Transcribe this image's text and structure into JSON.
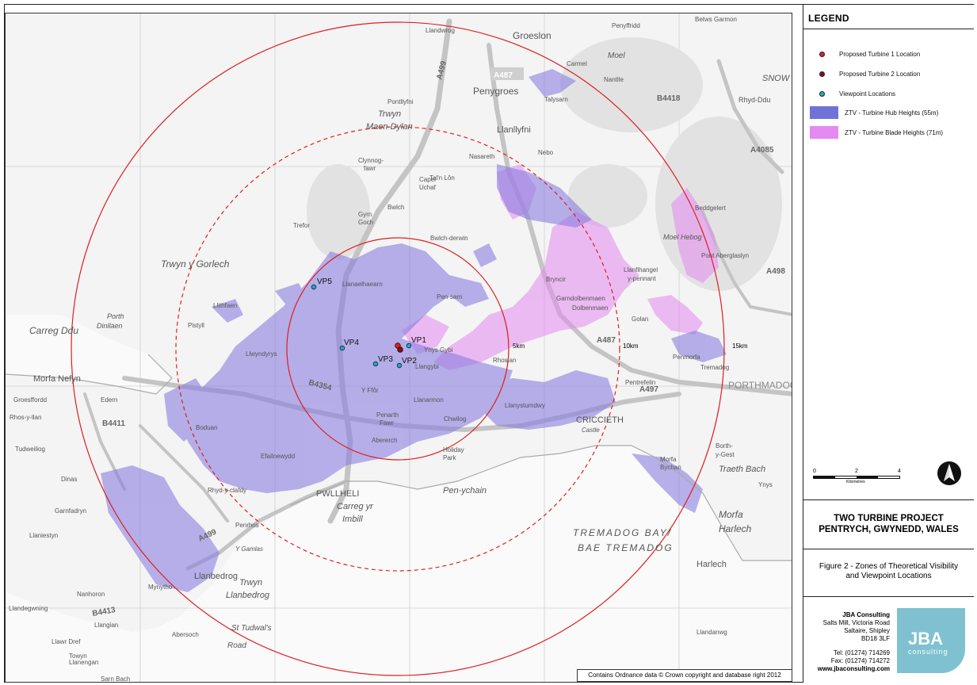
{
  "legend": {
    "title": "LEGEND",
    "items": [
      {
        "label": "Proposed Turbine 1 Location",
        "kind": "dot",
        "color": "#e02020"
      },
      {
        "label": "Proposed Turbine 2 Location",
        "kind": "dot",
        "color": "#7a1515"
      },
      {
        "label": "Viewpoint Locations",
        "kind": "dot",
        "color": "#2aa3c9"
      },
      {
        "label": "ZTV - Turbine Hub Heights (55m)",
        "kind": "swatch",
        "color": "#6f72d6"
      },
      {
        "label": "ZTV - Turbine Blade Heights (71m)",
        "kind": "swatch",
        "color": "#e48af0"
      }
    ]
  },
  "scale_bar": {
    "ticks": [
      "0",
      "2",
      "4"
    ],
    "unit": "Kilometres"
  },
  "project": {
    "line1": "TWO TURBINE PROJECT",
    "line2": "PENTRYCH, GWYNEDD, WALES"
  },
  "figure": {
    "line1": "Figure 2 - Zones of Theoretical Visibility",
    "line2": "and Viewpoint Locations"
  },
  "company": {
    "name": "JBA Consulting",
    "address1": "Salts Mill, Victoria Road",
    "address2": "Saltaire, Shipley",
    "postcode": "BD18 3LF",
    "tel": "Tel: (01274) 714269",
    "fax": "Fax: (01274) 714272",
    "web": "www.jbaconsulting.com",
    "logo_text": "JBA",
    "logo_sub": "consulting",
    "brand_color": "#7fc1d1"
  },
  "copyright": "Contains Ordnance data © Crown copyright and database right 2012",
  "rings": [
    {
      "label": "5km",
      "style": "solid"
    },
    {
      "label": "10km",
      "style": "dashed"
    },
    {
      "label": "15km",
      "style": "solid"
    }
  ],
  "viewpoints": [
    "VP1",
    "VP2",
    "VP3",
    "VP4",
    "VP5"
  ],
  "place_labels": {
    "groeslon": "Groeslon",
    "penygroes": "Penygroes",
    "trwyn_maen_dylan": "Trwyn",
    "maen_dylan": "Maen Dylan",
    "pontllyfni": "Pontllyfni",
    "llanllyfni": "Llanllyfni",
    "talysarn": "Talysarn",
    "nantlle": "Nantlle",
    "carmel": "Carmel",
    "llandwrog": "Llandwrog",
    "moel_tryfan": "Moel",
    "rhyd_ddu": "Rhyd-Ddu",
    "snowdon": "SNOW",
    "clynnog": "Clynnog-",
    "clynnog2": "fawr",
    "nasareth": "Nasareth",
    "nebo": "Nebo",
    "tal_y_lon": "Tal'n Lôn",
    "capel_uchaf": "Capel",
    "capel_uchaf2": "Uchaf",
    "gyrn_goch": "Gyrn",
    "gyrn_goch2": "Goch",
    "bwlch_mawr": "Bwlch",
    "trefor": "Trefor",
    "trwyn_gorlech": "Trwyn y Gorlech",
    "bwlch_derwin": "Bwlch-derwin",
    "llanaelhaearn": "Llanaelhaearn",
    "pen_sarn": "Pen-sarn",
    "bryncir": "Bryncir",
    "llanfihangel": "Llanfihangel",
    "llanfihangel2": "y-pennant",
    "garndolbenmaen": "Garndolbenmaen",
    "dolbenmaen": "Dolbenmaen",
    "golan": "Golan",
    "beddgelert": "Beddgelert",
    "moel_hebog": "Moel Hebog",
    "aberglaslyn": "Pont Aberglaslyn",
    "carreg_ddu": "Carreg Ddu",
    "porth_dinllaen": "Porth",
    "porth_dinllaen2": "Dinllaen",
    "morfa_nefyn": "Morfa Nefyn",
    "llithfaen": "Llithfaen",
    "pistyll": "Pistyll",
    "llwyndyrys": "Llwyndyrys",
    "ynys_gybi": "Ynys Gybi",
    "rhoslan": "Rhoslan",
    "penmorfa": "Penmorfa",
    "tremadog": "Tremadog",
    "porthmadog": "PORTHMADOG",
    "pentrefelin": "Pentrefelin",
    "criccieth": "CRICCIETH",
    "castle": "Castle",
    "llanystumdwy": "Llanystumdwy",
    "chwilog": "Chwilog",
    "llanarmon": "Llanarmon",
    "llangybi": "Llangybi",
    "y_ffor": "Y Ffôr",
    "abererch": "Abererch",
    "penarth_fawr": "Penarth",
    "penarth_fawr2": "Fawr",
    "holiday_park": "Holiday",
    "holiday_park2": "Park",
    "pen_ychain": "Pen-ychain",
    "pwllheli": "PWLLHELI",
    "carreg_yr_imbill": "Carreg yr",
    "carreg_yr_imbill2": "Imbill",
    "efailnewydd": "Efailnewydd",
    "boduan": "Boduan",
    "edern": "Edern",
    "groesffordd": "Groesffordd",
    "rhos_y_llan": "Rhos-y-llan",
    "tudweiliog": "Tudweiliog",
    "dinas": "Dinas",
    "garnfadryn": "Garnfadryn",
    "llaniestyn": "Llaniestyn",
    "rhydyclafdy": "Rhyd-y-clafdy",
    "penrhos": "Penrhos",
    "y_gamlas": "Y Gamlas",
    "llanbedrog": "Llanbedrog",
    "trwyn_llanbedrog": "Trwyn",
    "trwyn_llanbedrog2": "Llanbedrog",
    "mynytho": "Mynytho",
    "nanhoron": "Nanhoron",
    "llangian": "Llangian",
    "abersoch": "Abersoch",
    "st_tudwals": "St Tudwal's",
    "st_tudwals2": "Road",
    "llanengan": "Llanengan",
    "sarn_bach": "Sarn Bach",
    "llawr_dref": "Llawr Dref",
    "towyn": "Towyn",
    "llandegwning": "Llandegwning",
    "tremadog_bay": "TREMADOG BAY/",
    "bae_tremadog": "BAE TREMADOG",
    "harlech": "Harlech",
    "morfa_harlech": "Morfa",
    "morfa_harlech2": "Harlech",
    "morfa_bychan": "Morfa",
    "morfa_bychan2": "Bychan",
    "borth_y_gest": "Borth-",
    "borth_y_gest2": "y-Gest",
    "traeth_bach": "Traeth Bach",
    "ynys": "Ynys",
    "llandanwg": "Llandanwg",
    "penyffridd": "Penyffridd",
    "betws_garmon": "Betws Garmon"
  },
  "road_labels": {
    "a499_n": "A499",
    "a487": "A487",
    "a4085": "A4085",
    "b4418": "B4418",
    "a498": "A498",
    "a497": "A497",
    "b4354": "B4354",
    "a499_s": "A499",
    "a487_e": "A487",
    "b4413": "B4413",
    "b4411": "B4411"
  }
}
